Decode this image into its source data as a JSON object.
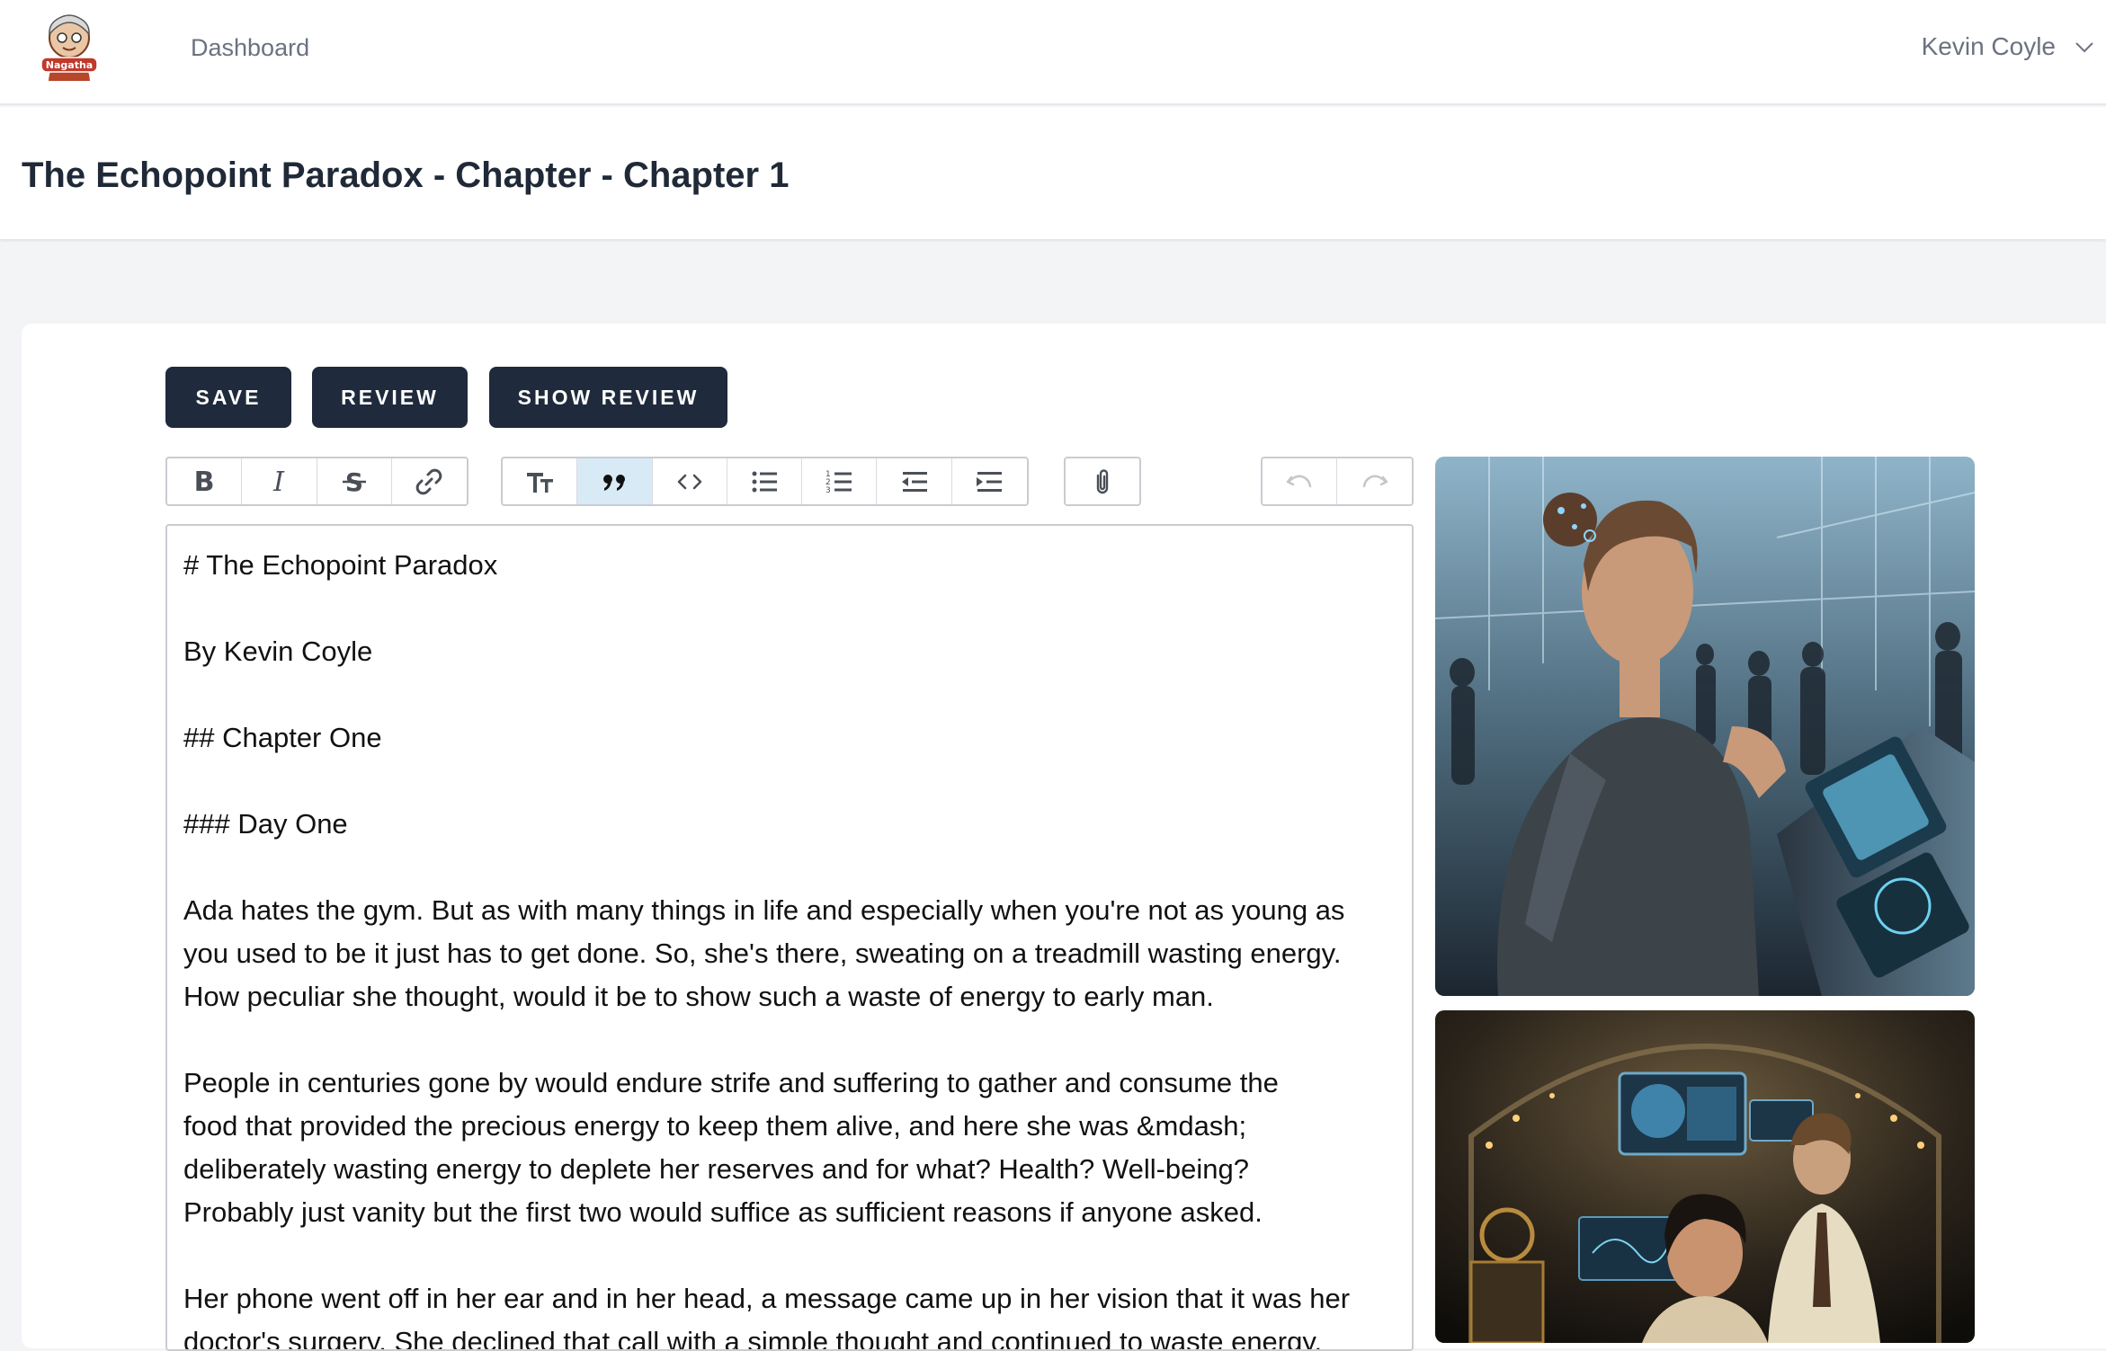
{
  "app": {
    "logo_text": "Nagatha",
    "nav_link": "Dashboard",
    "user_name": "Kevin Coyle"
  },
  "page": {
    "title": "The Echopoint Paradox - Chapter - Chapter 1"
  },
  "actions": {
    "save": "SAVE",
    "review": "REVIEW",
    "show_review": "SHOW REVIEW"
  },
  "toolbar": {
    "groups": [
      [
        "bold-icon",
        "italic-icon",
        "strikethrough-icon",
        "link-icon"
      ],
      [
        "heading-icon",
        "quote-icon",
        "code-icon",
        "bullet-list-icon",
        "numbered-list-icon",
        "outdent-icon",
        "indent-icon"
      ],
      [
        "attach-icon"
      ],
      [
        "undo-icon",
        "redo-icon"
      ]
    ],
    "active": "quote-icon"
  },
  "editor": {
    "lines": [
      "# The Echopoint Paradox",
      "",
      "By Kevin Coyle",
      "",
      "## Chapter One",
      "",
      "### Day One",
      "",
      "Ada hates the gym. But as with many things in life and especially when you're not as young as",
      "you used to be it just has to get done. So, she's there, sweating on a treadmill wasting energy.",
      "How peculiar she thought, would it be to show such a waste of energy to early man.",
      "",
      "People in centuries gone by would endure strife and suffering to gather and consume the",
      "food that provided the precious energy to keep them alive, and here she was &mdash;",
      "deliberately wasting energy to deplete her reserves and for what? Health? Well-being?",
      "Probably just vanity but the first two would suffice as sufficient reasons if anyone asked.",
      "",
      "Her phone went off in her ear and in her head, a message came up in her vision that it was her",
      "doctor's surgery. She declined that call with a simple thought and continued to waste energy."
    ]
  },
  "images": [
    {
      "name": "gym-treadmill-illustration"
    },
    {
      "name": "lab-scene-illustration"
    }
  ],
  "colors": {
    "button_bg": "#1f2a3c",
    "active_tool": "#d8eaf6"
  }
}
